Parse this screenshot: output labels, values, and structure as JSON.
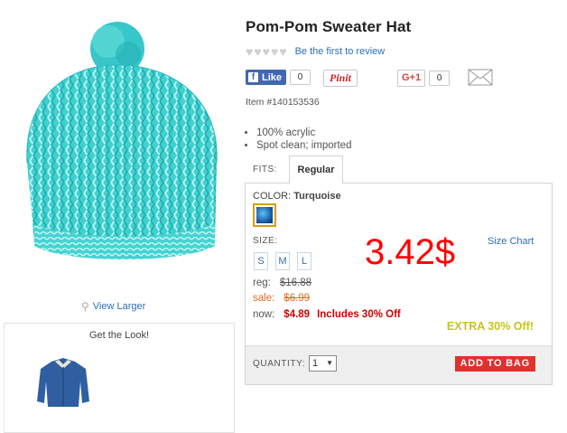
{
  "product": {
    "title": "Pom-Pom Sweater Hat",
    "review_link": "Be the first to review",
    "rating_hearts": 5,
    "item_number": "Item #140153536",
    "bullets": [
      "100% acrylic",
      "Spot clean; imported"
    ]
  },
  "social": {
    "fb_label": "Like",
    "fb_count": "0",
    "pinit_label": "Pinit",
    "gplus_label": "G+1",
    "gplus_count": "0"
  },
  "images": {
    "view_larger": "View Larger",
    "get_the_look": "Get the Look!"
  },
  "options": {
    "fits_label": "FITS:",
    "fit_selected": "Regular",
    "color_label": "COLOR:",
    "color_value": "Turquoise",
    "size_label": "SIZE:",
    "sizes": [
      "S",
      "M",
      "L"
    ],
    "size_chart": "Size Chart"
  },
  "pricing": {
    "overlay_price": "3.42$",
    "reg_label": "reg:",
    "reg_price": "$16.88",
    "sale_label": "sale:",
    "sale_price": "$6.99",
    "now_label": "now:",
    "now_price": "$4.89",
    "now_note": "Includes 30% Off",
    "extra_off": "EXTRA 30% Off!"
  },
  "cart": {
    "quantity_label": "QUANTITY:",
    "quantity_value": "1",
    "add_to_bag": "ADD TO BAG"
  },
  "colors": {
    "link_blue": "#2a6ebb",
    "hat_turquoise": "#3fd1d0",
    "price_red": "#cc0000",
    "overlay_red": "#ff0000",
    "add_button": "#e0312f",
    "extra_off": "#c5c519"
  }
}
